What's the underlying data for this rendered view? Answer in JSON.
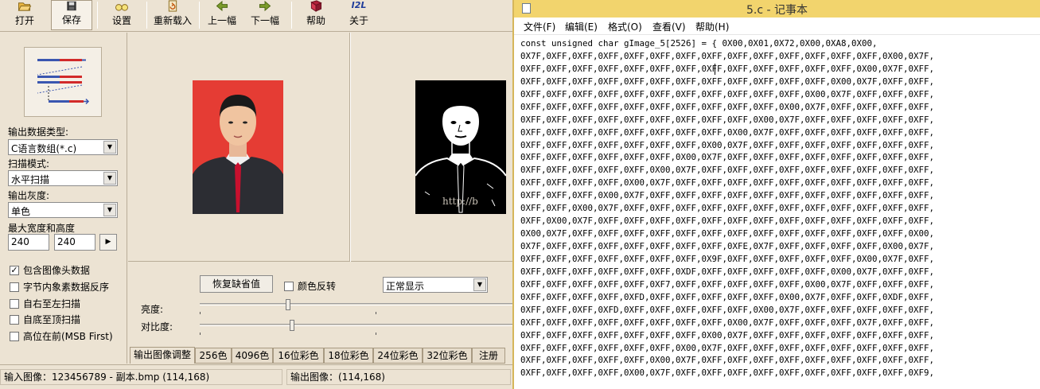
{
  "toolbar": {
    "buttons": [
      {
        "label": "打开",
        "icon": "folder-open-icon"
      },
      {
        "label": "保存",
        "icon": "floppy-disk-icon"
      },
      {
        "label": "设置",
        "icon": "glasses-icon"
      },
      {
        "label": "重新载入",
        "icon": "reload-icon"
      },
      {
        "label": "上一幅",
        "icon": "arrow-left-icon"
      },
      {
        "label": "下一幅",
        "icon": "arrow-right-icon"
      },
      {
        "label": "帮助",
        "icon": "help-book-icon"
      },
      {
        "label": "关于",
        "icon": "about-icon"
      }
    ],
    "about_icon_text": "I2L"
  },
  "left_panel": {
    "output_type_label": "输出数据类型:",
    "output_type_value": "C语言数组(*.c)",
    "scan_mode_label": "扫描模式:",
    "scan_mode_value": "水平扫描",
    "gray_label": "输出灰度:",
    "gray_value": "单色",
    "max_size_label": "最大宽度和高度",
    "max_width": "240",
    "max_height": "240",
    "options": [
      {
        "label": "包含图像头数据",
        "checked": true
      },
      {
        "label": "字节内象素数据反序",
        "checked": false
      },
      {
        "label": "自右至左扫描",
        "checked": false
      },
      {
        "label": "自底至顶扫描",
        "checked": false
      },
      {
        "label": "高位在前(MSB First)",
        "checked": false
      }
    ]
  },
  "preview": {
    "watermark": "http://b"
  },
  "adjust": {
    "restore_button": "恢复缺省值",
    "invert_label": "颜色反转",
    "invert_checked": false,
    "display_mode": "正常显示",
    "brightness_label": "亮度:",
    "contrast_label": "对比度:",
    "brightness_level": 0.5,
    "contrast_level": 0.52,
    "tabs": [
      "输出图像调整",
      "256色",
      "4096色",
      "16位彩色",
      "18位彩色",
      "24位彩色",
      "32位彩色",
      "注册"
    ],
    "active_tab": 0
  },
  "status": {
    "input_image": "输入图像：123456789 - 副本.bmp (114,168)",
    "output_image": "输出图像：(114,168)"
  },
  "notepad": {
    "title": "5.c - 记事本",
    "menu": [
      "文件(F)",
      "编辑(E)",
      "格式(O)",
      "查看(V)",
      "帮助(H)"
    ],
    "lines": [
      "const unsigned char gImage_5[2526] = { 0X00,0X01,0X72,0X00,0XA8,0X00,",
      "0X7F,0XFF,0XFF,0XFF,0XFF,0XFF,0XFF,0XFF,0XFF,0XFF,0XFF,0XFF,0XFF,0XFF,0X00,0X7F,",
      "0XFF,0XFF,0XFF,0XFF,0XFF,0XFF,0XFF,0XFF,0XFF,0XFF,0XFF,0XFF,0XFF,0X00,0X7F,0XFF,",
      "0XFF,0XFF,0XFF,0XFF,0XFF,0XFF,0XFF,0XFF,0XFF,0XFF,0XFF,0XFF,0X00,0X7F,0XFF,0XFF,",
      "0XFF,0XFF,0XFF,0XFF,0XFF,0XFF,0XFF,0XFF,0XFF,0XFF,0XFF,0X00,0X7F,0XFF,0XFF,0XFF,",
      "0XFF,0XFF,0XFF,0XFF,0XFF,0XFF,0XFF,0XFF,0XFF,0XFF,0X00,0X7F,0XFF,0XFF,0XFF,0XFF,",
      "0XFF,0XFF,0XFF,0XFF,0XFF,0XFF,0XFF,0XFF,0XFF,0X00,0X7F,0XFF,0XFF,0XFF,0XFF,0XFF,",
      "0XFF,0XFF,0XFF,0XFF,0XFF,0XFF,0XFF,0XFF,0X00,0X7F,0XFF,0XFF,0XFF,0XFF,0XFF,0XFF,",
      "0XFF,0XFF,0XFF,0XFF,0XFF,0XFF,0XFF,0X00,0X7F,0XFF,0XFF,0XFF,0XFF,0XFF,0XFF,0XFF,",
      "0XFF,0XFF,0XFF,0XFF,0XFF,0XFF,0X00,0X7F,0XFF,0XFF,0XFF,0XFF,0XFF,0XFF,0XFF,0XFF,",
      "0XFF,0XFF,0XFF,0XFF,0XFF,0X00,0X7F,0XFF,0XFF,0XFF,0XFF,0XFF,0XFF,0XFF,0XFF,0XFF,",
      "0XFF,0XFF,0XFF,0XFF,0X00,0X7F,0XFF,0XFF,0XFF,0XFF,0XFF,0XFF,0XFF,0XFF,0XFF,0XFF,",
      "0XFF,0XFF,0XFF,0X00,0X7F,0XFF,0XFF,0XFF,0XFF,0XFF,0XFF,0XFF,0XFF,0XFF,0XFF,0XFF,",
      "0XFF,0XFF,0X00,0X7F,0XFF,0XFF,0XFF,0XFF,0XFF,0XFF,0XFF,0XFF,0XFF,0XFF,0XFF,0XFF,",
      "0XFF,0X00,0X7F,0XFF,0XFF,0XFF,0XFF,0XFF,0XFF,0XFF,0XFF,0XFF,0XFF,0XFF,0XFF,0XFF,",
      "0X00,0X7F,0XFF,0XFF,0XFF,0XFF,0XFF,0XFF,0XFF,0XFF,0XFF,0XFF,0XFF,0XFF,0XFF,0X00,",
      "0X7F,0XFF,0XFF,0XFF,0XFF,0XFF,0XFF,0XFF,0XFE,0X7F,0XFF,0XFF,0XFF,0XFF,0X00,0X7F,",
      "0XFF,0XFF,0XFF,0XFF,0XFF,0XFF,0XFF,0X9F,0XFF,0XFF,0XFF,0XFF,0XFF,0X00,0X7F,0XFF,",
      "0XFF,0XFF,0XFF,0XFF,0XFF,0XFF,0XDF,0XFF,0XFF,0XFF,0XFF,0XFF,0X00,0X7F,0XFF,0XFF,",
      "0XFF,0XFF,0XFF,0XFF,0XFF,0XF7,0XFF,0XFF,0XFF,0XFF,0XFF,0X00,0X7F,0XFF,0XFF,0XFF,",
      "0XFF,0XFF,0XFF,0XFF,0XFD,0XFF,0XFF,0XFF,0XFF,0XFF,0X00,0X7F,0XFF,0XFF,0XDF,0XFF,",
      "0XFF,0XFF,0XFF,0XFD,0XFF,0XFF,0XFF,0XFF,0XFF,0X00,0X7F,0XFF,0XFF,0XFF,0XFF,0XFF,",
      "0XFF,0XFF,0XFF,0XFF,0XFF,0XFF,0XFF,0XFF,0X00,0X7F,0XFF,0XFF,0XFF,0X7F,0XFF,0XFF,",
      "0XFF,0XFF,0XFF,0XFF,0XFF,0XFF,0XFF,0X00,0X7F,0XFF,0XFF,0XFF,0XFF,0XFF,0XFF,0XFF,",
      "0XFF,0XFF,0XFF,0XFF,0XFF,0XFF,0X00,0X7F,0XFF,0XFF,0XFF,0XFF,0XFF,0XFF,0XFF,0XFF,",
      "0XFF,0XFF,0XFF,0XFF,0XFF,0X00,0X7F,0XFF,0XFF,0XFF,0XFF,0XFF,0XFF,0XFF,0XFF,0XFF,",
      "0XFF,0XFF,0XFF,0XFF,0X00,0X7F,0XFF,0XFF,0XFF,0XFF,0XFF,0XFF,0XFF,0XFF,0XFF,0XF9,"
    ]
  },
  "colors": {
    "app_background": "#ece3d3",
    "notepad_title": "#f2d46d",
    "photo_background": "#e53c34",
    "tie": "#c8102e"
  }
}
